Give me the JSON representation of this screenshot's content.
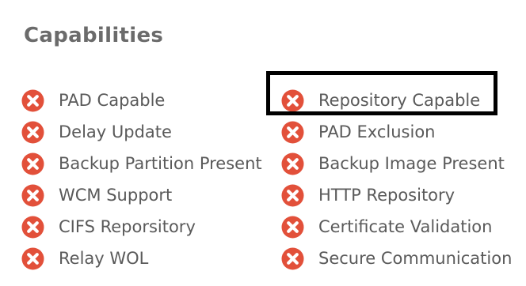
{
  "section": {
    "title": "Capabilities"
  },
  "colors": {
    "status_error": "#e2503a",
    "highlight_border": "#000000",
    "text": "#5a5a5a"
  },
  "capabilities": {
    "left": [
      {
        "label": "PAD Capable",
        "icon": "error-x-icon"
      },
      {
        "label": "Delay Update",
        "icon": "error-x-icon"
      },
      {
        "label": "Backup Partition Present",
        "icon": "error-x-icon"
      },
      {
        "label": "WCM Support",
        "icon": "error-x-icon"
      },
      {
        "label": "CIFS Reporsitory",
        "icon": "error-x-icon"
      },
      {
        "label": "Relay WOL",
        "icon": "error-x-icon"
      }
    ],
    "right": [
      {
        "label": "Repository Capable",
        "icon": "error-x-icon",
        "highlighted": true
      },
      {
        "label": "PAD Exclusion",
        "icon": "error-x-icon"
      },
      {
        "label": "Backup Image Present",
        "icon": "error-x-icon"
      },
      {
        "label": "HTTP Repository",
        "icon": "error-x-icon"
      },
      {
        "label": "Certificate Validation",
        "icon": "error-x-icon"
      },
      {
        "label": "Secure Communication",
        "icon": "error-x-icon"
      }
    ]
  }
}
